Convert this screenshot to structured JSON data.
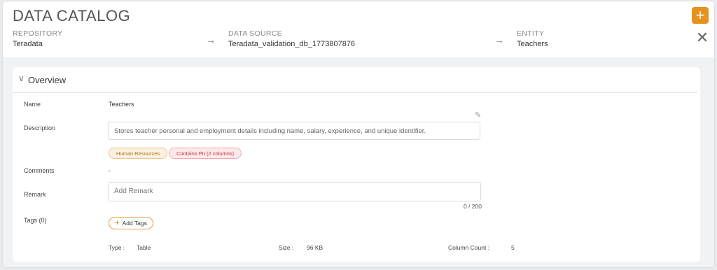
{
  "header": {
    "title": "DATA CATALOG",
    "breadcrumbs": [
      {
        "label": "REPOSITORY",
        "value": "Teradata"
      },
      {
        "label": "DATA SOURCE",
        "value": "Teradata_validation_db_1773807876"
      },
      {
        "label": "ENTITY",
        "value": "Teachers"
      }
    ],
    "add_icon": "plus-icon",
    "close_icon": "close-icon"
  },
  "overview": {
    "title": "Overview",
    "fields": {
      "name_label": "Name",
      "name_value": "Teachers",
      "description_label": "Description",
      "description_value": "Stores teacher personal and employment details including name, salary, experience, and unique identifier.",
      "comments_label": "Comments",
      "comments_value": "-",
      "remark_label": "Remark",
      "remark_placeholder": "Add Remark",
      "remark_counter": "0 / 200",
      "tags_label": "Tags (0)",
      "add_tags_label": "Add Tags"
    },
    "chips": [
      {
        "label": "Human Resources",
        "color": "#b5741c"
      },
      {
        "label": "Contains PII (2 columns)",
        "color": "#c9323c"
      }
    ],
    "meta": {
      "type_label": "Type :",
      "type_value": "Table",
      "size_label": "Size :",
      "size_value": "96 KB",
      "column_count_label": "Column Count :",
      "column_count_value": "5"
    }
  },
  "colors": {
    "accent": "#e6921e"
  }
}
